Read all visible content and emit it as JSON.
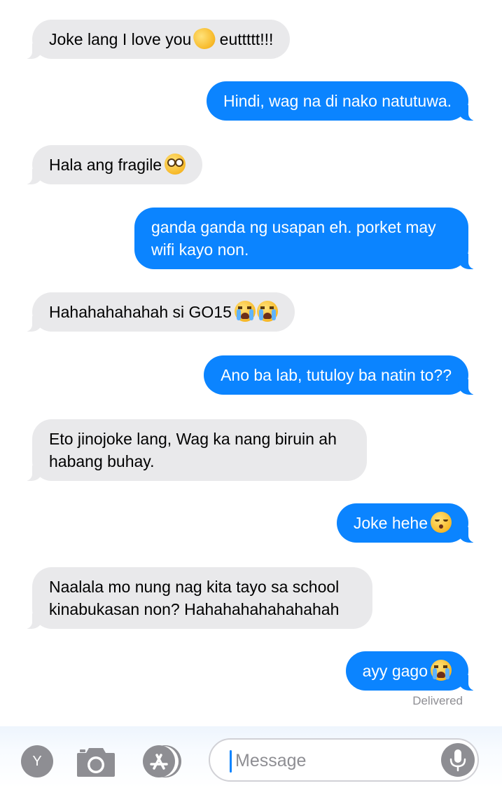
{
  "messages": [
    {
      "direction": "incoming",
      "text": "Joke lang I love you",
      "emoji": [
        "fist-emoji"
      ],
      "trailing_text": " euttttt!!!"
    },
    {
      "direction": "outgoing",
      "text": "Hindi, wag na di nako natutuwa.",
      "emoji": [],
      "trailing_text": ""
    },
    {
      "direction": "incoming",
      "text": "Hala ang fragile",
      "emoji": [
        "flushed-face-emoji"
      ],
      "trailing_text": ""
    },
    {
      "direction": "outgoing",
      "text": "ganda ganda ng usapan eh. porket may wifi kayo non.",
      "emoji": [],
      "trailing_text": ""
    },
    {
      "direction": "incoming",
      "text": "Hahahahahahah si GO15",
      "emoji": [
        "loudly-crying-face-emoji",
        "loudly-crying-face-emoji"
      ],
      "trailing_text": ""
    },
    {
      "direction": "outgoing",
      "text": "Ano ba lab, tutuloy ba natin to??",
      "emoji": [],
      "trailing_text": ""
    },
    {
      "direction": "incoming",
      "text": "Eto jinojoke lang, Wag ka nang biruin ah habang buhay.",
      "emoji": [],
      "trailing_text": ""
    },
    {
      "direction": "outgoing",
      "text": "Joke hehe",
      "emoji": [
        "kissing-face-emoji"
      ],
      "trailing_text": ""
    },
    {
      "direction": "incoming",
      "text": "Naalala mo nung nag kita tayo sa school kinabukasan non? Hahahahahahahahah",
      "emoji": [],
      "trailing_text": ""
    },
    {
      "direction": "outgoing",
      "text": "ayy gago",
      "emoji": [
        "loudly-crying-face-emoji"
      ],
      "trailing_text": ""
    }
  ],
  "status": {
    "delivered": "Delivered"
  },
  "toolbar": {
    "avatar_initial": "Y",
    "camera_icon": "camera-icon",
    "appstore_icon": "app-store-icon",
    "mic_icon": "microphone-icon",
    "message_placeholder": "Message"
  },
  "colors": {
    "incoming_bubble": "#e9e9eb",
    "outgoing_bubble": "#0b84ff",
    "status_text": "#8e8e93",
    "toolbar_icon": "#8e8e93"
  }
}
